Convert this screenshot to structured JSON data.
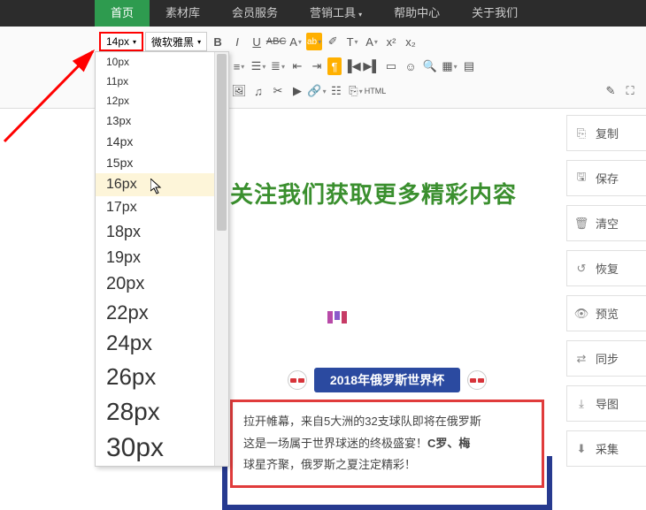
{
  "nav": {
    "items": [
      "首页",
      "素材库",
      "会员服务",
      "营销工具",
      "帮助中心",
      "关于我们"
    ],
    "active_index": 0,
    "dropdown_indices": [
      3
    ]
  },
  "toolbar": {
    "fontsize_sel": "14px",
    "fontfamily_sel": "微软雅黑"
  },
  "fontsize_options": [
    {
      "label": "10px",
      "size": 12
    },
    {
      "label": "11px",
      "size": 12
    },
    {
      "label": "12px",
      "size": 12
    },
    {
      "label": "13px",
      "size": 13
    },
    {
      "label": "14px",
      "size": 14
    },
    {
      "label": "15px",
      "size": 14
    },
    {
      "label": "16px",
      "size": 16,
      "selected": true
    },
    {
      "label": "17px",
      "size": 16
    },
    {
      "label": "18px",
      "size": 18
    },
    {
      "label": "19px",
      "size": 18
    },
    {
      "label": "20px",
      "size": 20
    },
    {
      "label": "22px",
      "size": 22
    },
    {
      "label": "24px",
      "size": 24
    },
    {
      "label": "26px",
      "size": 26
    },
    {
      "label": "28px",
      "size": 28
    },
    {
      "label": "30px",
      "size": 30
    }
  ],
  "content": {
    "headline": "关注我们获取更多精彩内容",
    "article_title": "2018年俄罗斯世界杯",
    "article_body_1": "拉开帷幕，来自5大洲的32支球队即将在俄罗斯",
    "article_body_2": "这是一场属于世界球迷的终极盛宴！",
    "article_body_2b": "C罗、梅",
    "article_body_3": "球星齐聚，俄罗斯之夏注定精彩！"
  },
  "side_actions": [
    {
      "icon": "copy",
      "label": "复制"
    },
    {
      "icon": "save",
      "label": "保存"
    },
    {
      "icon": "trash",
      "label": "清空"
    },
    {
      "icon": "undo",
      "label": "恢复"
    },
    {
      "icon": "eye",
      "label": "预览"
    },
    {
      "icon": "sync",
      "label": "同步"
    },
    {
      "icon": "export",
      "label": "导图"
    },
    {
      "icon": "collect",
      "label": "采集"
    }
  ]
}
